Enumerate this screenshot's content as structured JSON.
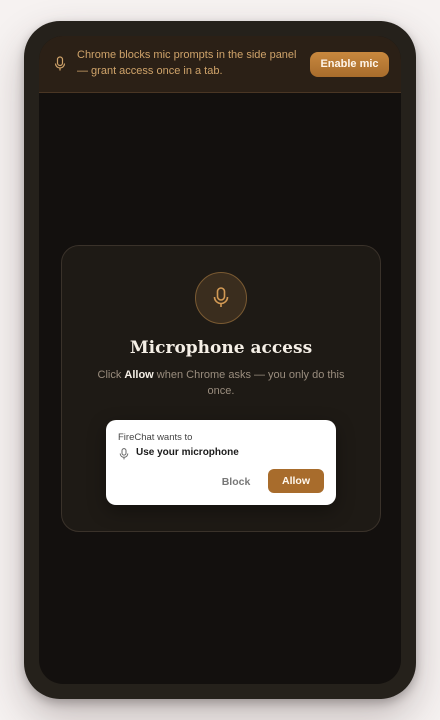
{
  "banner": {
    "icon": "microphone-icon",
    "message": "Chrome blocks mic prompts in the side panel — grant access once in a tab.",
    "button_label": "Enable mic"
  },
  "card": {
    "icon": "microphone-icon",
    "title": "Microphone access",
    "desc_prefix": "Click ",
    "desc_bold": "Allow",
    "desc_suffix": " when Chrome asks — you only do this once."
  },
  "permission_prompt": {
    "origin_text": "FireChat wants to",
    "icon": "microphone-icon",
    "request_text": "Use your microphone",
    "block_label": "Block",
    "allow_label": "Allow"
  },
  "colors": {
    "accent": "#a86c2c",
    "banner_text": "#cfa36a",
    "background": "#13100e"
  }
}
